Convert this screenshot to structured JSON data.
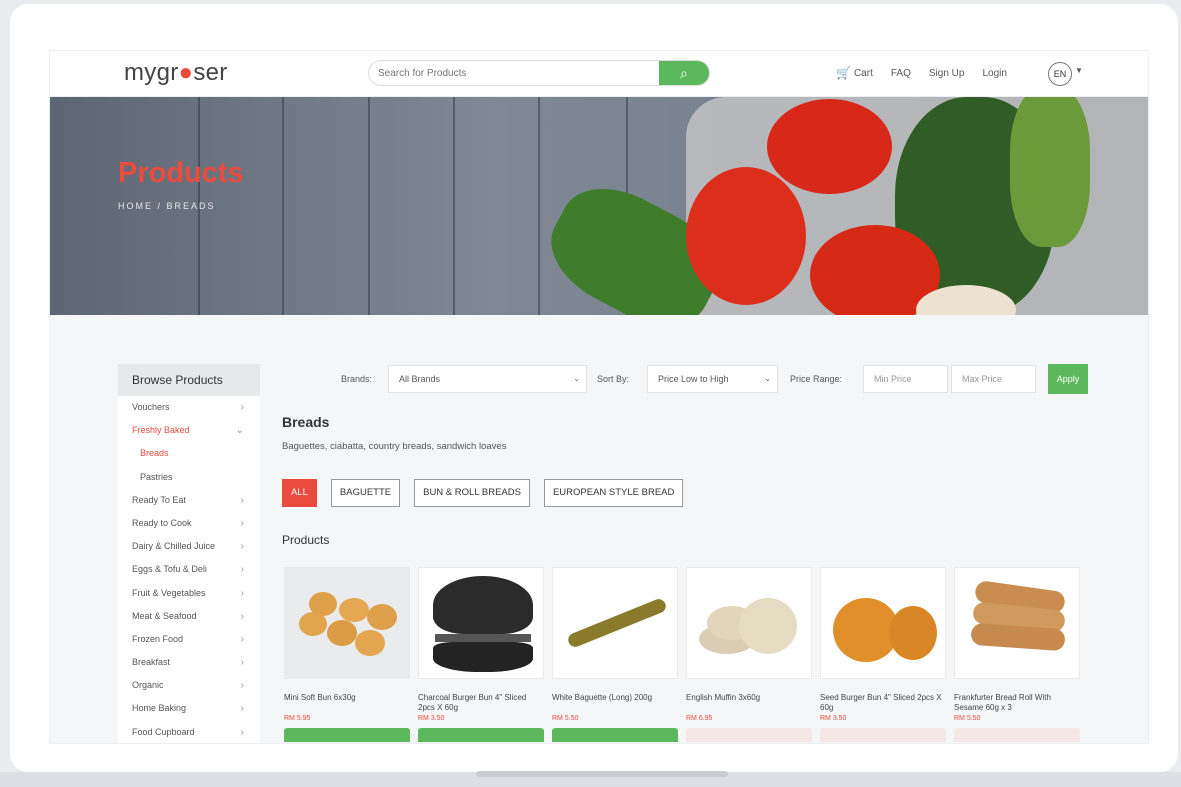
{
  "header": {
    "logo_left": "mygr",
    "logo_right": "ser",
    "search_placeholder": "Search for Products",
    "search_icon": "search-icon",
    "nav": {
      "cart": "Cart",
      "faq": "FAQ",
      "signup": "Sign Up",
      "login": "Login"
    },
    "lang": "EN"
  },
  "banner": {
    "title": "Products",
    "breadcrumb": "HOME / BREADS"
  },
  "sidebar": {
    "title": "Browse Products",
    "items": [
      {
        "label": "Vouchers"
      },
      {
        "label": "Freshly Baked"
      },
      {
        "label": "Breads"
      },
      {
        "label": "Pastries"
      },
      {
        "label": "Ready To Eat"
      },
      {
        "label": "Ready to Cook"
      },
      {
        "label": "Dairy & Chilled Juice"
      },
      {
        "label": "Eggs & Tofu & Deli"
      },
      {
        "label": "Fruit & Vegetables"
      },
      {
        "label": "Meat & Seafood"
      },
      {
        "label": "Frozen Food"
      },
      {
        "label": "Breakfast"
      },
      {
        "label": "Organic"
      },
      {
        "label": "Home Baking"
      },
      {
        "label": "Food Cupboard"
      }
    ]
  },
  "filters": {
    "brands_label": "Brands:",
    "brands_value": "All Brands",
    "sort_label": "Sort By:",
    "sort_value": "Price Low to High",
    "price_label": "Price Range:",
    "min_placeholder": "Min Price",
    "max_placeholder": "Max Price",
    "apply": "Apply"
  },
  "category": {
    "title": "Breads",
    "description": "Baguettes, ciabatta, country breads, sandwich loaves"
  },
  "chips": [
    "ALL",
    "BAGUETTE",
    "BUN & ROLL BREADS",
    "EUROPEAN STYLE BREAD"
  ],
  "products_title": "Products",
  "products": [
    {
      "name": "Mini Soft Bun 6x30g",
      "price": "RM 5.95"
    },
    {
      "name": "Charcoal Burger Bun 4\" Sliced 2pcs X 60g",
      "price": "RM 3.50"
    },
    {
      "name": "White Baguette (Long) 200g",
      "price": "RM 5.50"
    },
    {
      "name": "English Muffin 3x60g",
      "price": "RM 6.95"
    },
    {
      "name": "Seed Burger Bun 4\" Sliced 2pcs X 60g",
      "price": "RM 3.50"
    },
    {
      "name": "Frankfurter Bread Roll With Sesame 60g x 3",
      "price": "RM 5.50"
    }
  ],
  "colors": {
    "accent": "#e94b3c",
    "green": "#5cb85c"
  }
}
